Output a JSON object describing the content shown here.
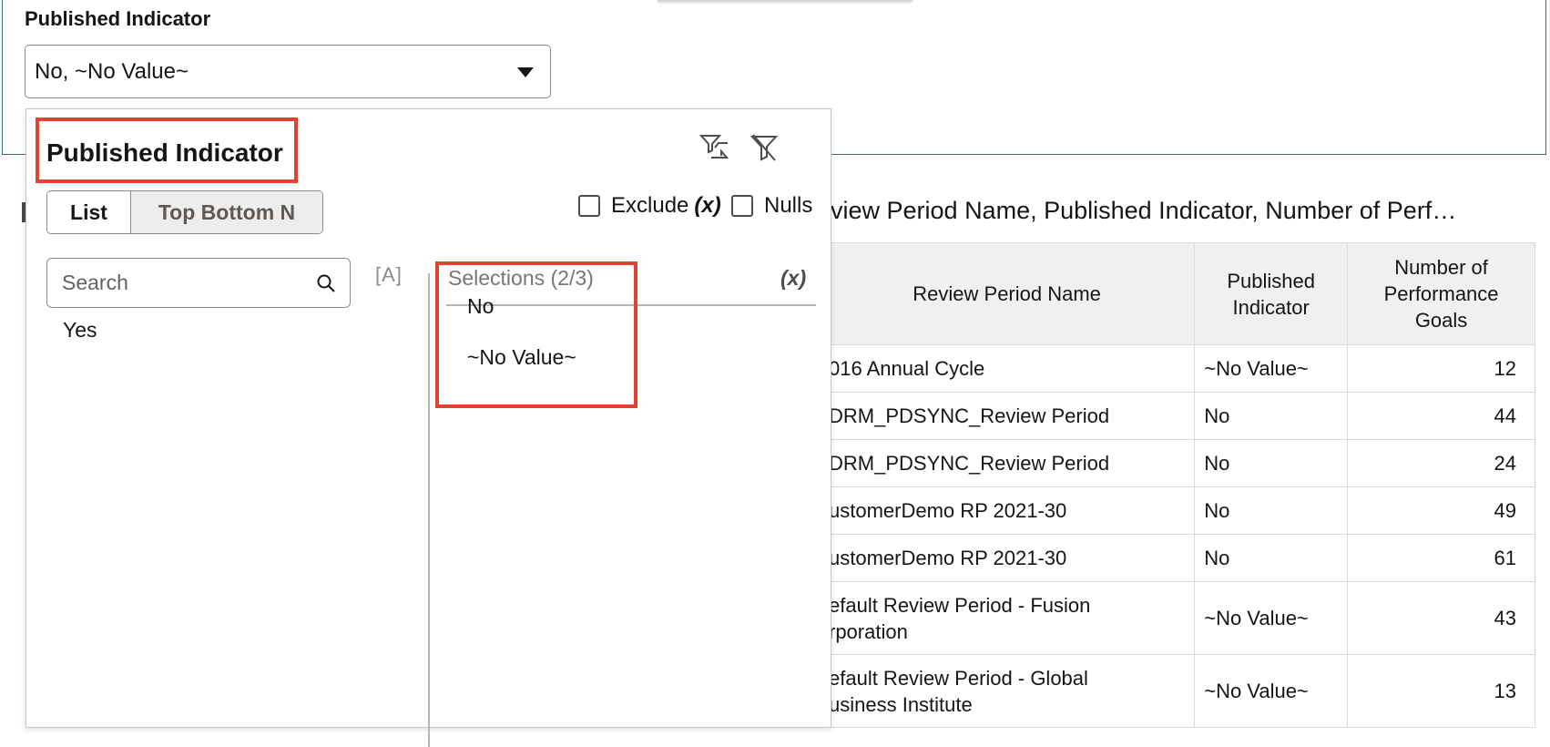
{
  "prompt": {
    "label": "Published Indicator",
    "selected_value": "No, ~No Value~"
  },
  "popup": {
    "title": "Published Indicator",
    "tabs": {
      "list": "List",
      "top_bottom_n": "Top Bottom N"
    },
    "exclude_label": "Exclude",
    "exclude_suffix": "(x)",
    "nulls_label": "Nulls",
    "search_placeholder": "Search",
    "case_toggle": "[A]",
    "available_items": [
      "Yes"
    ],
    "selections_header": "Selections (2/3)",
    "selections_clear": "(x)",
    "selected_items": [
      "No",
      "~No Value~"
    ]
  },
  "report": {
    "title": "view Period Name, Published Indicator, Number of Perf…",
    "columns": [
      "Review Period Name",
      "Published Indicator",
      "Number of Performance Goals"
    ],
    "rows": [
      [
        "016 Annual Cycle",
        "~No Value~",
        "12"
      ],
      [
        "DRM_PDSYNC_Review Period",
        "No",
        "44"
      ],
      [
        "DRM_PDSYNC_Review Period",
        "No",
        "24"
      ],
      [
        "ustomerDemo RP 2021-30",
        "No",
        "49"
      ],
      [
        "ustomerDemo RP 2021-30",
        "No",
        "61"
      ],
      [
        "efault Review Period - Fusion\nrporation",
        "~No Value~",
        "43"
      ],
      [
        "efault Review Period - Global\nusiness Institute",
        "~No Value~",
        "13"
      ]
    ]
  },
  "colors": {
    "highlight": "#e2432e",
    "frame": "#3a6f86"
  }
}
